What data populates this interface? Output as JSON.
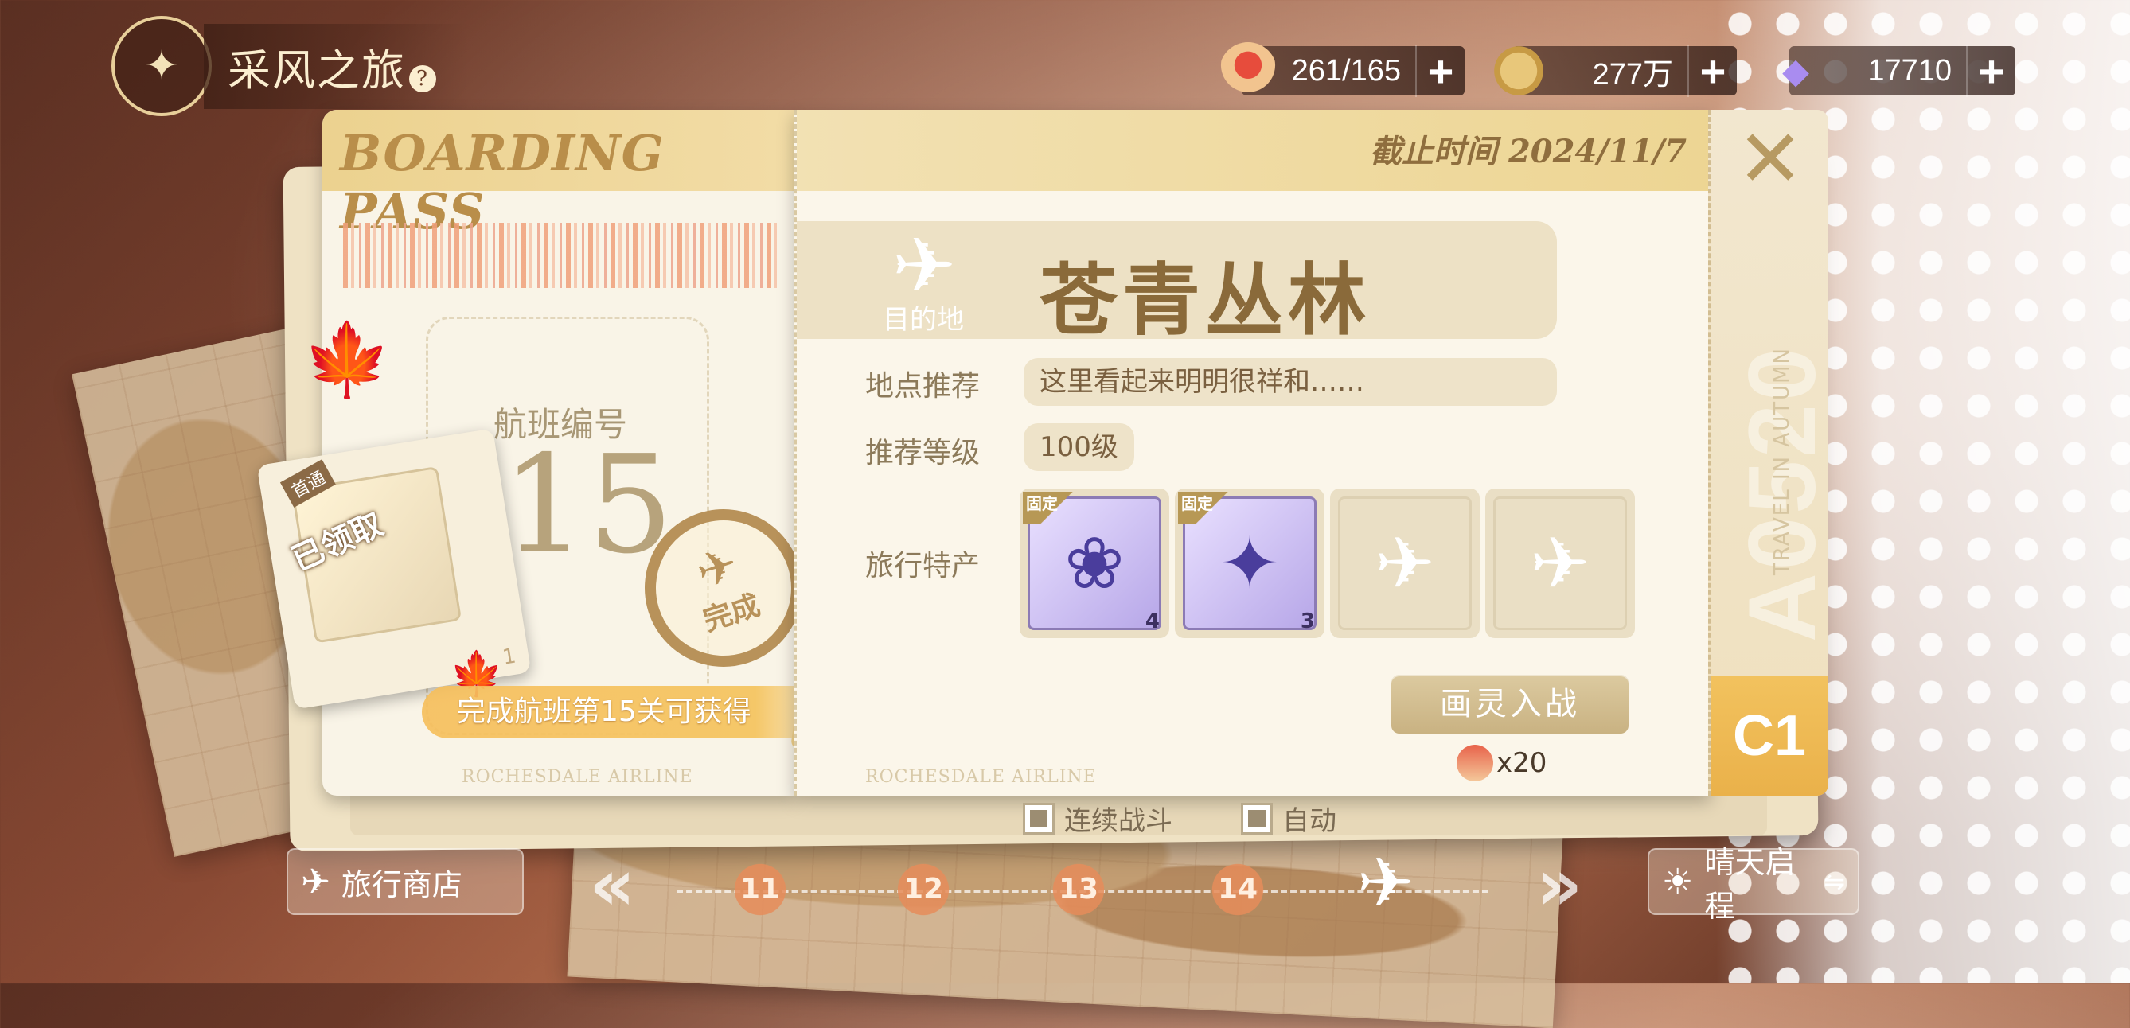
{
  "header": {
    "title": "采风之旅",
    "resources": [
      {
        "name": "stamina",
        "icon": "strawberry-cake-icon",
        "value": "261/165"
      },
      {
        "name": "coins",
        "icon": "coin-icon",
        "value": "277万"
      },
      {
        "name": "gems",
        "icon": "diamond-icon",
        "value": "17710"
      }
    ]
  },
  "ticket": {
    "boarding_title": "BOARDING PASS",
    "flight_label": "航班编号",
    "flight_number": "15",
    "stamp_text": "完成",
    "reward": {
      "tag": "首通",
      "status": "已领取",
      "count": "1"
    },
    "clear_reward_text": "完成航班第15关可获得",
    "airline": "ROCHESDALE AIRLINE",
    "deadline": "截止时间 2024/11/7",
    "destination_label": "目的地",
    "destination_name": "苍青丛林",
    "location_label": "地点推荐",
    "location_text": "这里看起来明明很祥和……",
    "level_label": "推荐等级",
    "level_value": "100级",
    "specialty_label": "旅行特产",
    "items": [
      {
        "tag": "固定",
        "icon": "butterfly-ornament-icon",
        "count": "4"
      },
      {
        "tag": "固定",
        "icon": "crystal-ornament-icon",
        "count": "3"
      },
      {
        "icon": "airplane-placeholder-icon"
      },
      {
        "icon": "airplane-placeholder-icon"
      }
    ],
    "continuous_battle": "连续战斗",
    "auto": "自动",
    "battle_button": "画灵入战",
    "cost": "x20",
    "stub_code": "A0520",
    "stub_motto": "TRAVEL IN AUTUMN",
    "stub_class": "C1"
  },
  "bottom_nav": {
    "shop": "旅行商店",
    "stages": [
      "11",
      "12",
      "13",
      "14"
    ],
    "weather": "晴天启程"
  },
  "colors": {
    "ticket_header": "#edd593",
    "accent_gold": "#eab14a",
    "text_brown": "#8a6a3a"
  }
}
